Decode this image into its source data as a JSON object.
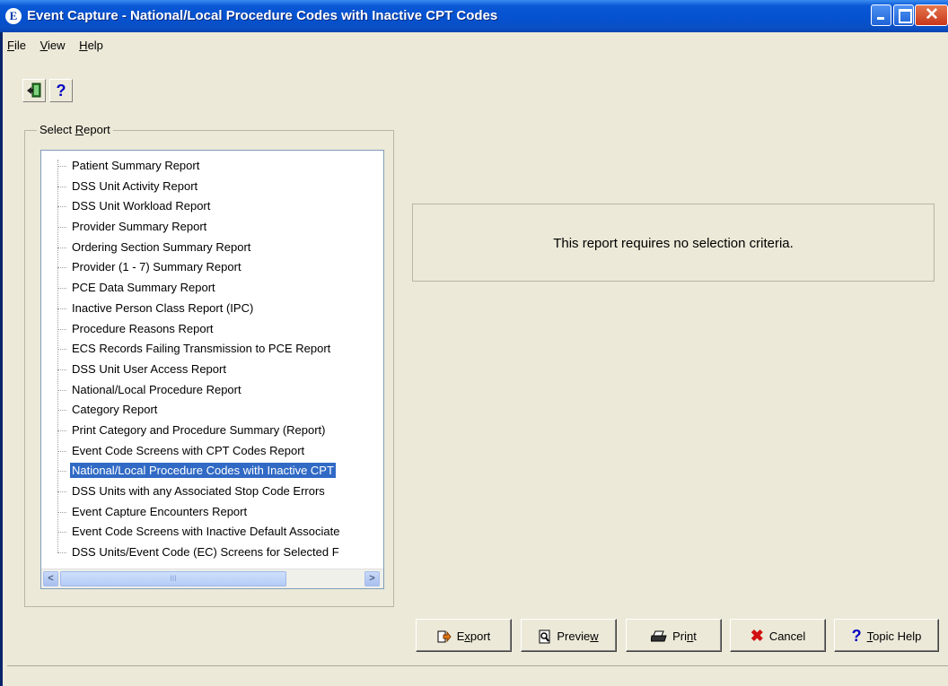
{
  "window": {
    "title": "Event Capture - National/Local Procedure Codes with Inactive CPT Codes",
    "app_icon_letter": "E"
  },
  "menu": {
    "file": {
      "accel": "F",
      "rest": "ile"
    },
    "view": {
      "accel": "V",
      "rest": "iew"
    },
    "help": {
      "accel": "H",
      "rest": "elp"
    }
  },
  "toolbar": {
    "exit_icon": "exit-door-icon",
    "help_glyph": "?"
  },
  "select_report": {
    "label_prefix": "Select ",
    "label_accel": "R",
    "label_rest": "eport",
    "items": [
      "Patient Summary Report",
      "DSS Unit Activity Report",
      "DSS Unit Workload Report",
      "Provider Summary Report",
      "Ordering Section Summary Report",
      "Provider (1 - 7) Summary Report",
      "PCE Data Summary Report",
      "Inactive Person Class Report (IPC)",
      "Procedure Reasons Report",
      "ECS Records Failing Transmission to PCE Report",
      "DSS Unit User Access Report",
      "National/Local Procedure Report",
      "Category Report",
      "Print Category and Procedure Summary (Report)",
      "Event Code Screens with CPT Codes Report",
      "National/Local Procedure Codes with Inactive CPT",
      "DSS Units with any Associated Stop Code Errors",
      "Event Capture Encounters Report",
      "Event Code Screens with Inactive Default Associate",
      "DSS Units/Event Code (EC) Screens for Selected F"
    ],
    "selected_index": 15,
    "scroll": {
      "left": "<",
      "right": ">",
      "thumb_grip": "III"
    }
  },
  "criteria": {
    "message": "This report requires no selection criteria."
  },
  "buttons": {
    "export": {
      "accel": "x",
      "pre": "E",
      "post": "port"
    },
    "preview": {
      "pre": "Previe",
      "accel": "w",
      "post": ""
    },
    "print": {
      "pre": "Pri",
      "accel": "n",
      "post": "t"
    },
    "cancel": {
      "label": "Cancel",
      "glyph": "✖"
    },
    "topic_help": {
      "accel": "T",
      "post": "opic Help",
      "glyph": "?"
    }
  },
  "colors": {
    "title_bar": "#0552d0",
    "selection": "#316ac5",
    "window_bg": "#ece9d8"
  }
}
